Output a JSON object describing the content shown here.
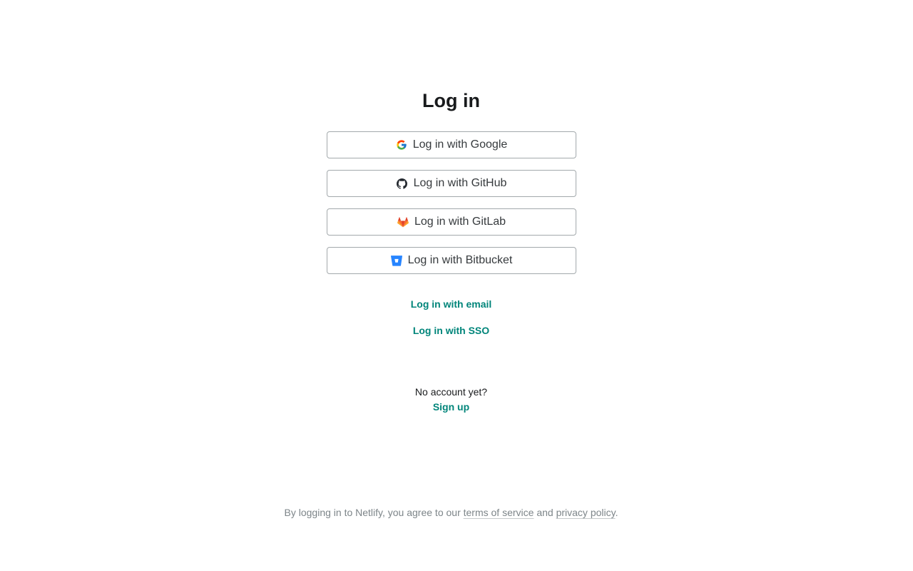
{
  "page": {
    "title": "Log in"
  },
  "providers": [
    {
      "label": "Log in with Google",
      "icon": "google-icon"
    },
    {
      "label": "Log in with GitHub",
      "icon": "github-icon"
    },
    {
      "label": "Log in with GitLab",
      "icon": "gitlab-icon"
    },
    {
      "label": "Log in with Bitbucket",
      "icon": "bitbucket-icon"
    }
  ],
  "links": {
    "email": "Log in with email",
    "sso": "Log in with SSO"
  },
  "signup": {
    "prompt": "No account yet?",
    "link": "Sign up"
  },
  "legal": {
    "prefix": "By logging in to Netlify, you agree to our ",
    "terms": "terms of service",
    "and": " and ",
    "privacy": "privacy policy",
    "suffix": "."
  },
  "colors": {
    "link": "#00857a",
    "text": "#181a1c",
    "button_text": "#363a3d",
    "button_border": "#a3a9ac",
    "muted": "#7d8589"
  }
}
